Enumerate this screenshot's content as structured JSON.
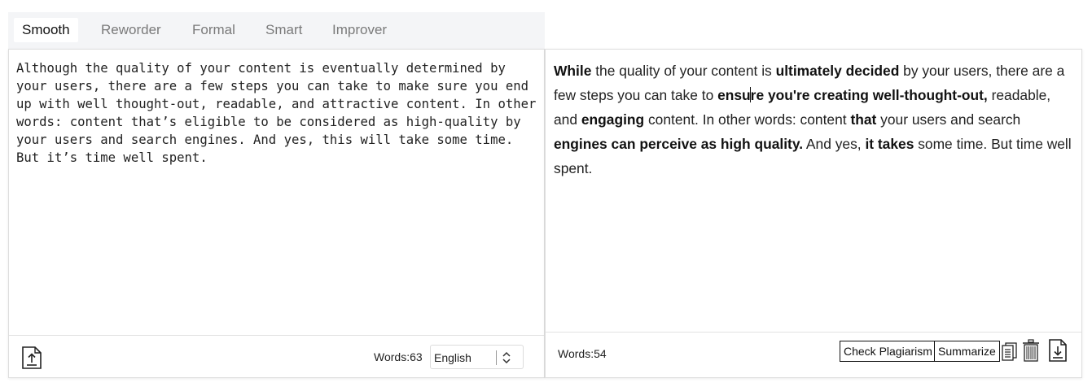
{
  "tabs": [
    {
      "label": "Smooth",
      "active": true
    },
    {
      "label": "Reworder",
      "active": false
    },
    {
      "label": "Formal",
      "active": false
    },
    {
      "label": "Smart",
      "active": false
    },
    {
      "label": "Improver",
      "active": false
    }
  ],
  "input": {
    "text": "Although the quality of your content is eventually determined by your users, there are a few steps you can take to make sure you end up with well thought-out, readable, and attractive content. In other words: content that’s eligible to be considered as high-quality by your users and search engines. And yes, this will take some time. But it’s time well spent.",
    "word_count_label": "Words:63",
    "language": "English",
    "upload_icon": "upload-file-icon"
  },
  "output": {
    "segments": [
      {
        "text": "While",
        "bold": true
      },
      {
        "text": " the quality of your content is ",
        "bold": false
      },
      {
        "text": "ultimately decided",
        "bold": true
      },
      {
        "text": " by your users, there are a few steps you can take to ",
        "bold": false
      },
      {
        "text": "ensu",
        "bold": true
      },
      {
        "text": "",
        "caret": true
      },
      {
        "text": "re you're creating well-thought-out,",
        "bold": true
      },
      {
        "text": " readable, and ",
        "bold": false
      },
      {
        "text": "engaging",
        "bold": true
      },
      {
        "text": " content. In other words: content ",
        "bold": false
      },
      {
        "text": "that",
        "bold": true
      },
      {
        "text": " your users and search ",
        "bold": false
      },
      {
        "text": "engines can perceive as high quality.",
        "bold": true
      },
      {
        "text": " And yes, ",
        "bold": false
      },
      {
        "text": "it takes",
        "bold": true
      },
      {
        "text": " some time. But time well spent.",
        "bold": false
      }
    ],
    "word_count_label": "Words:54",
    "check_plagiarism_label": "Check Plagiarism",
    "summarize_label": "Summarize",
    "icons": [
      "copy-icon",
      "trash-icon",
      "download-file-icon"
    ]
  }
}
